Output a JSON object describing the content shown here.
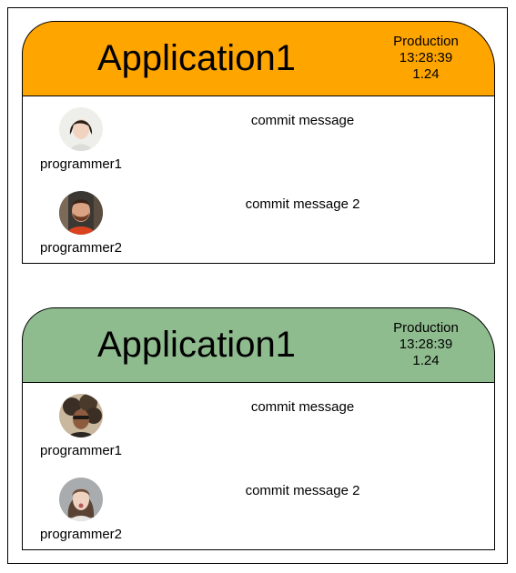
{
  "colors": {
    "card1_header": "#ffa500",
    "card2_header": "#8fbc8f",
    "border": "#000000"
  },
  "deployments": [
    {
      "title": "Application1",
      "environment": "Production",
      "time": "13:28:39",
      "version": "1.24",
      "commits": [
        {
          "message": "commit message",
          "author": "programmer1",
          "avatar_icon": "avatar-woman-dark-bob-icon"
        },
        {
          "message": "commit message 2",
          "author": "programmer2",
          "avatar_icon": "avatar-man-beard-icon"
        }
      ]
    },
    {
      "title": "Application1",
      "environment": "Production",
      "time": "13:28:39",
      "version": "1.24",
      "commits": [
        {
          "message": "commit message",
          "author": "programmer1",
          "avatar_icon": "avatar-woman-curly-hair-icon"
        },
        {
          "message": "commit message 2",
          "author": "programmer2",
          "avatar_icon": "avatar-woman-blonde-icon"
        }
      ]
    }
  ]
}
